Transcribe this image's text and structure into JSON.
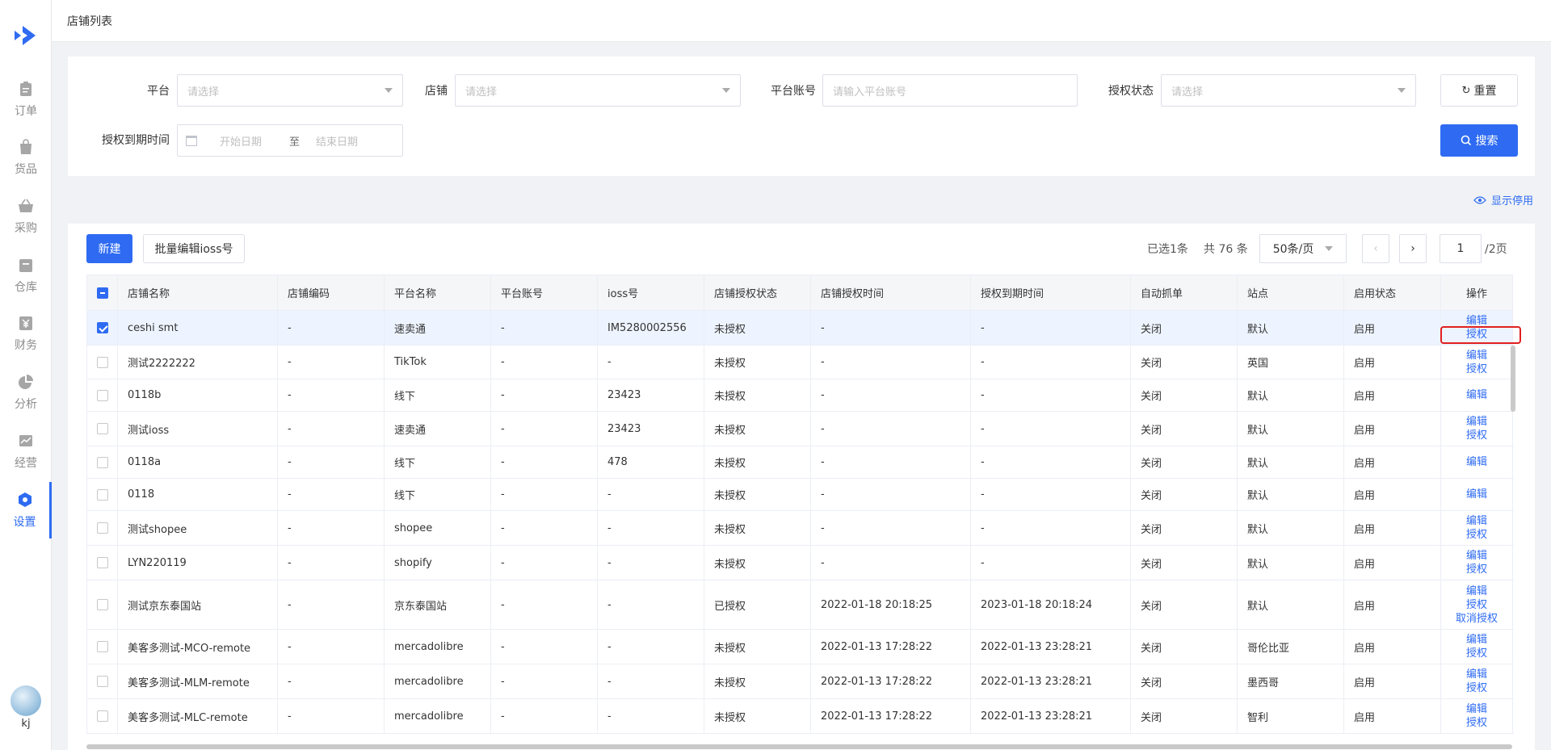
{
  "page": {
    "title": "店铺列表"
  },
  "sidebar": {
    "items": [
      {
        "label": "订单",
        "icon": "clipboard-icon"
      },
      {
        "label": "货品",
        "icon": "bag-icon"
      },
      {
        "label": "采购",
        "icon": "basket-icon"
      },
      {
        "label": "仓库",
        "icon": "warehouse-icon"
      },
      {
        "label": "财务",
        "icon": "yen-icon"
      },
      {
        "label": "分析",
        "icon": "pie-chart-icon"
      },
      {
        "label": "经营",
        "icon": "trend-chart-icon"
      },
      {
        "label": "设置",
        "icon": "settings-icon"
      }
    ],
    "user": {
      "name": "kj"
    }
  },
  "filters": {
    "platform": {
      "label": "平台",
      "placeholder": "请选择"
    },
    "shop": {
      "label": "店铺",
      "placeholder": "请选择"
    },
    "account": {
      "label": "平台账号",
      "placeholder": "请输入平台账号"
    },
    "auth_status": {
      "label": "授权状态",
      "placeholder": "请选择"
    },
    "expire_time": {
      "label": "授权到期时间",
      "start_placeholder": "开始日期",
      "separator": "至",
      "end_placeholder": "结束日期"
    },
    "reset_label": "重置",
    "search_label": "搜索"
  },
  "show_disabled_label": "显示停用",
  "toolbar": {
    "new_label": "新建",
    "batch_ioss_label": "批量编辑ioss号",
    "selected_text": "已选1条",
    "total_text": "共 76 条",
    "page_size": "50条/页",
    "current_page": "1",
    "total_pages": "/2页"
  },
  "table": {
    "columns": [
      "店铺名称",
      "店铺编码",
      "平台名称",
      "平台账号",
      "ioss号",
      "店铺授权状态",
      "店铺授权时间",
      "授权到期时间",
      "自动抓单",
      "站点",
      "启用状态",
      "操作"
    ],
    "rows": [
      {
        "name": "ceshi smt",
        "code": "-",
        "platform": "速卖通",
        "account": "-",
        "ioss": "IM5280002556",
        "auth": "未授权",
        "auth_time": "-",
        "expire": "-",
        "auto": "关闭",
        "site": "默认",
        "enabled": "启用",
        "actions": [
          "编辑",
          "授权"
        ],
        "selected": true
      },
      {
        "name": "测试2222222",
        "code": "-",
        "platform": "TikTok",
        "account": "-",
        "ioss": "-",
        "auth": "未授权",
        "auth_time": "-",
        "expire": "-",
        "auto": "关闭",
        "site": "英国",
        "enabled": "启用",
        "actions": [
          "编辑",
          "授权"
        ]
      },
      {
        "name": "0118b",
        "code": "-",
        "platform": "线下",
        "account": "-",
        "ioss": "23423",
        "auth": "未授权",
        "auth_time": "-",
        "expire": "-",
        "auto": "关闭",
        "site": "默认",
        "enabled": "启用",
        "actions": [
          "编辑"
        ]
      },
      {
        "name": "测试ioss",
        "code": "-",
        "platform": "速卖通",
        "account": "-",
        "ioss": "23423",
        "auth": "未授权",
        "auth_time": "-",
        "expire": "-",
        "auto": "关闭",
        "site": "默认",
        "enabled": "启用",
        "actions": [
          "编辑",
          "授权"
        ]
      },
      {
        "name": "0118a",
        "code": "-",
        "platform": "线下",
        "account": "-",
        "ioss": "478",
        "auth": "未授权",
        "auth_time": "-",
        "expire": "-",
        "auto": "关闭",
        "site": "默认",
        "enabled": "启用",
        "actions": [
          "编辑"
        ]
      },
      {
        "name": "0118",
        "code": "-",
        "platform": "线下",
        "account": "-",
        "ioss": "-",
        "auth": "未授权",
        "auth_time": "-",
        "expire": "-",
        "auto": "关闭",
        "site": "默认",
        "enabled": "启用",
        "actions": [
          "编辑"
        ]
      },
      {
        "name": "测试shopee",
        "code": "-",
        "platform": "shopee",
        "account": "-",
        "ioss": "-",
        "auth": "未授权",
        "auth_time": "-",
        "expire": "-",
        "auto": "关闭",
        "site": "默认",
        "enabled": "启用",
        "actions": [
          "编辑",
          "授权"
        ]
      },
      {
        "name": "LYN220119",
        "code": "-",
        "platform": "shopify",
        "account": "-",
        "ioss": "-",
        "auth": "未授权",
        "auth_time": "-",
        "expire": "-",
        "auto": "关闭",
        "site": "默认",
        "enabled": "启用",
        "actions": [
          "编辑",
          "授权"
        ]
      },
      {
        "name": "测试京东泰国站",
        "code": "-",
        "platform": "京东泰国站",
        "account": "-",
        "ioss": "-",
        "auth": "已授权",
        "auth_time": "2022-01-18 20:18:25",
        "expire": "2023-01-18 20:18:24",
        "auto": "关闭",
        "site": "默认",
        "enabled": "启用",
        "actions": [
          "编辑",
          "授权",
          "取消授权"
        ]
      },
      {
        "name": "美客多测试-MCO-remote",
        "code": "-",
        "platform": "mercadolibre",
        "account": "-",
        "ioss": "-",
        "auth": "未授权",
        "auth_time": "2022-01-13 17:28:22",
        "expire": "2022-01-13 23:28:21",
        "auto": "关闭",
        "site": "哥伦比亚",
        "enabled": "启用",
        "actions": [
          "编辑",
          "授权"
        ]
      },
      {
        "name": "美客多测试-MLM-remote",
        "code": "-",
        "platform": "mercadolibre",
        "account": "-",
        "ioss": "-",
        "auth": "未授权",
        "auth_time": "2022-01-13 17:28:22",
        "expire": "2022-01-13 23:28:21",
        "auto": "关闭",
        "site": "墨西哥",
        "enabled": "启用",
        "actions": [
          "编辑",
          "授权"
        ]
      },
      {
        "name": "美客多测试-MLC-remote",
        "code": "-",
        "platform": "mercadolibre",
        "account": "-",
        "ioss": "-",
        "auth": "未授权",
        "auth_time": "2022-01-13 17:28:22",
        "expire": "2022-01-13 23:28:21",
        "auto": "关闭",
        "site": "智利",
        "enabled": "启用",
        "actions": [
          "编辑",
          "授权"
        ]
      }
    ]
  },
  "colors": {
    "primary": "#2e6bf2",
    "highlight": "#e02020"
  }
}
